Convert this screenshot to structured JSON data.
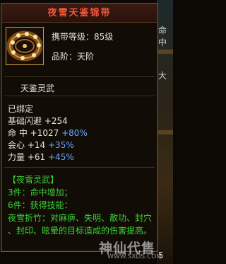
{
  "background": {
    "right_texts": [
      "命中",
      "大",
      "5"
    ]
  },
  "item": {
    "name": "夜雪天鉴锦带",
    "icon": "jeweled-belt-icon",
    "carry_level": "携带等级：85级",
    "grade": "品阶：天阶",
    "series": "天鉴灵武"
  },
  "status": "已绑定",
  "stats": [
    {
      "label": "基础闪避",
      "value": "+254",
      "bonus": ""
    },
    {
      "label": "命  中",
      "value": "+1027",
      "bonus": "+80%"
    },
    {
      "label": "会心",
      "value": "+14",
      "bonus": "+35%"
    },
    {
      "label": "力量",
      "value": "+61",
      "bonus": "+45%"
    }
  ],
  "set": {
    "title": "【夜雪灵武】",
    "bonus_3": "3件：命中增加；",
    "bonus_6": "6件：获得技能：",
    "skill_line1": "夜雪折竹：对麻痹、失明、散功、封穴",
    "skill_line2": "、封印、眩晕的目标造成的伤害提高。"
  },
  "watermark": {
    "text": "神仙代售",
    "url": "WWW.SXDS.COM"
  },
  "colors": {
    "title": "#ff5a3c",
    "set_text": "#39d43a",
    "bonus": "#6aa8ff",
    "border": "#c89a40"
  }
}
